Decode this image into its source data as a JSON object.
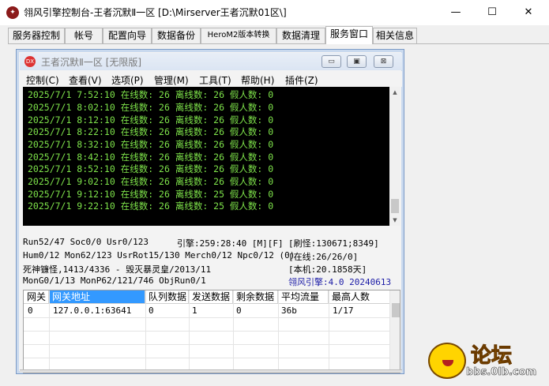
{
  "window": {
    "title": "翎风引擎控制台-王者沉默Ⅱ一区 [D:\\Mirserver王者沉默01区\\]",
    "minimize": "—",
    "maximize": "☐",
    "close": "✕"
  },
  "tabs": [
    {
      "label": "服务器控制"
    },
    {
      "label": "帐号"
    },
    {
      "label": "配置向导"
    },
    {
      "label": "数据备份"
    },
    {
      "label": "HeroM2版本转换"
    },
    {
      "label": "数据清理"
    },
    {
      "label": "服务窗口",
      "active": true
    },
    {
      "label": "相关信息"
    }
  ],
  "subwindow": {
    "icon_text": "DX",
    "title": "王者沉默Ⅱ一区 [无限版]",
    "btn_min": "▭",
    "btn_max": "▣",
    "btn_close": "⊠",
    "menu": [
      "控制(C)",
      "查看(V)",
      "选项(P)",
      "管理(M)",
      "工具(T)",
      "帮助(H)",
      "插件(Z)"
    ]
  },
  "log_lines": [
    "2025/7/1 7:52:10 在线数: 26 离线数: 26 假人数: 0",
    "2025/7/1 8:02:10 在线数: 26 离线数: 26 假人数: 0",
    "2025/7/1 8:12:10 在线数: 26 离线数: 26 假人数: 0",
    "2025/7/1 8:22:10 在线数: 26 离线数: 26 假人数: 0",
    "2025/7/1 8:32:10 在线数: 26 离线数: 26 假人数: 0",
    "2025/7/1 8:42:10 在线数: 26 离线数: 26 假人数: 0",
    "2025/7/1 8:52:10 在线数: 26 离线数: 26 假人数: 0",
    "2025/7/1 9:02:10 在线数: 26 离线数: 26 假人数: 0",
    "2025/7/1 9:12:10 在线数: 26 离线数: 25 假人数: 0",
    "2025/7/1 9:22:10 在线数: 26 离线数: 25 假人数: 0"
  ],
  "status": {
    "run": "Run52/47 Soc0/0 Usr0/123",
    "engine": "引擎:259:28:40 [M][F]",
    "refresh": "[刷怪:130671;8349]",
    "hum": "Hum0/12 Mon62/123 UsrRot15/130 Merch0/12 Npc0/12 (0)",
    "online": "[在线:26/26/0]",
    "boss": "死神镰怪,1413/4336 - 毁灭暴灵皇/2013/11",
    "local": "[本机:20.1858天]",
    "mongo": "MonG0/1/13 MonP62/121/746 ObjRun0/1",
    "version": "翎风引擎:4.0 20240613"
  },
  "gateway_table": {
    "headers": [
      "网关",
      "网关地址",
      "队列数据",
      "发送数据",
      "剩余数据",
      "平均流量",
      "最高人数"
    ],
    "rows": [
      [
        "0",
        "127.0.0.1:63641",
        "0",
        "1",
        "0",
        "36b",
        "1/17"
      ]
    ]
  },
  "watermark": {
    "text": "论坛",
    "url": "bbs.0lb.com"
  },
  "colors": {
    "console_bg": "#000000",
    "console_text": "#7ee34a",
    "header_selected": "#3399ff",
    "version_text": "#1a1aa6"
  }
}
